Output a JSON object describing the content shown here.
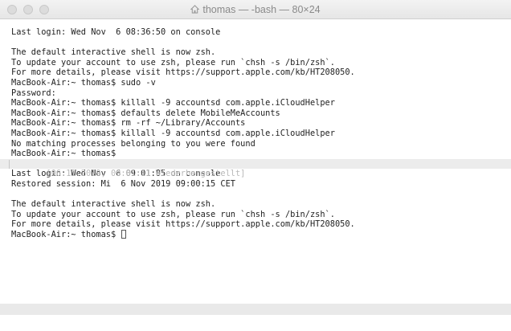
{
  "window": {
    "title": "thomas — -bash — 80×24"
  },
  "terminal": {
    "block1": [
      "Last login: Wed Nov  6 08:36:50 on console",
      "",
      "The default interactive shell is now zsh.",
      "To update your account to use zsh, please run `chsh -s /bin/zsh`.",
      "For more details, please visit https://support.apple.com/kb/HT208050.",
      "MacBook-Air:~ thomas$ sudo -v",
      "Password:",
      "MacBook-Air:~ thomas$ killall -9 accountsd com.apple.iCloudHelper",
      "MacBook-Air:~ thomas$ defaults delete MobileMeAccounts",
      "MacBook-Air:~ thomas$ rm -rf ~/Library/Accounts",
      "MacBook-Air:~ thomas$ killall -9 accountsd com.apple.iCloudHelper",
      "No matching processes belonging to you were found",
      "MacBook-Air:~ thomas$"
    ],
    "restored_marker": " [06.11.2019, 09:01:11 Wiederhergestellt]",
    "block2": [
      "Last login: Wed Nov  6 09:01:05 on console",
      "Restored session: Mi  6 Nov 2019 09:00:15 CET",
      "",
      "The default interactive shell is now zsh.",
      "To update your account to use zsh, please run `chsh -s /bin/zsh`.",
      "For more details, please visit https://support.apple.com/kb/HT208050."
    ],
    "prompt": "MacBook-Air:~ thomas$ "
  }
}
